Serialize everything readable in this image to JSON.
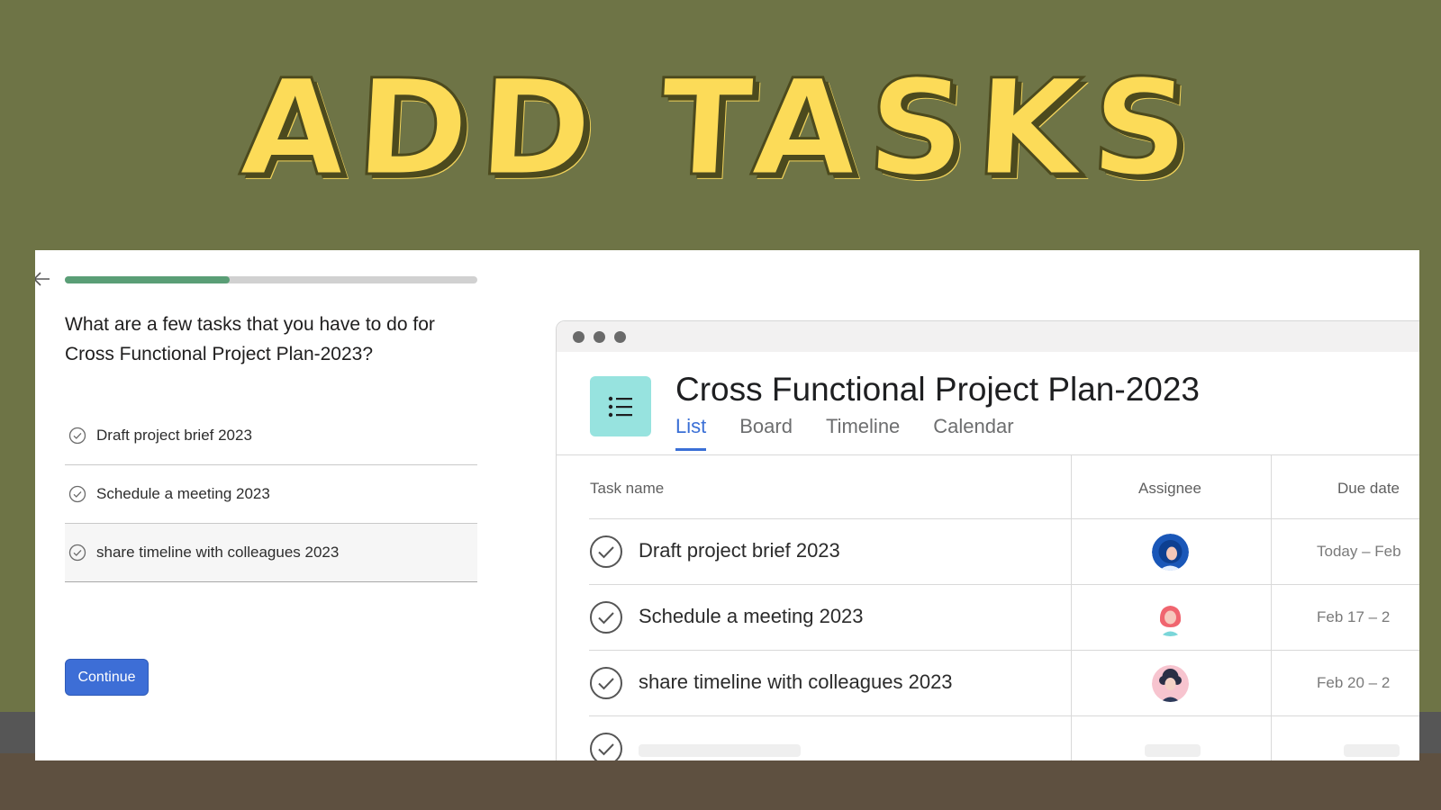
{
  "banner": {
    "title": "ADD TASKS"
  },
  "onboarding": {
    "progress": 0.4,
    "question": "What are a few tasks that you have to do for Cross Functional Project Plan-2023?",
    "tasks": [
      {
        "label": "Draft project brief 2023"
      },
      {
        "label": "Schedule a meeting 2023"
      },
      {
        "label": "share timeline with colleagues 2023"
      }
    ],
    "continue_label": "Continue"
  },
  "preview": {
    "project_title": "Cross Functional Project Plan-2023",
    "tabs": [
      {
        "label": "List",
        "active": true
      },
      {
        "label": "Board"
      },
      {
        "label": "Timeline"
      },
      {
        "label": "Calendar"
      }
    ],
    "columns": {
      "task": "Task name",
      "assignee": "Assignee",
      "due": "Due date"
    },
    "rows": [
      {
        "name": "Draft project brief 2023",
        "due": "Today – Feb",
        "avatar": "avatar-blue-hair"
      },
      {
        "name": "Schedule a meeting 2023",
        "due": "Feb 17 – 2",
        "avatar": "avatar-pink-hair"
      },
      {
        "name": "share timeline with colleagues 2023",
        "due": "Feb 20 – 2",
        "avatar": "avatar-curly-dark-hair"
      }
    ],
    "colors": {
      "accent": "#3a6fd6",
      "icon_bg": "#97e3df",
      "progress": "#5a9e76",
      "button": "#3d6ed6"
    }
  }
}
